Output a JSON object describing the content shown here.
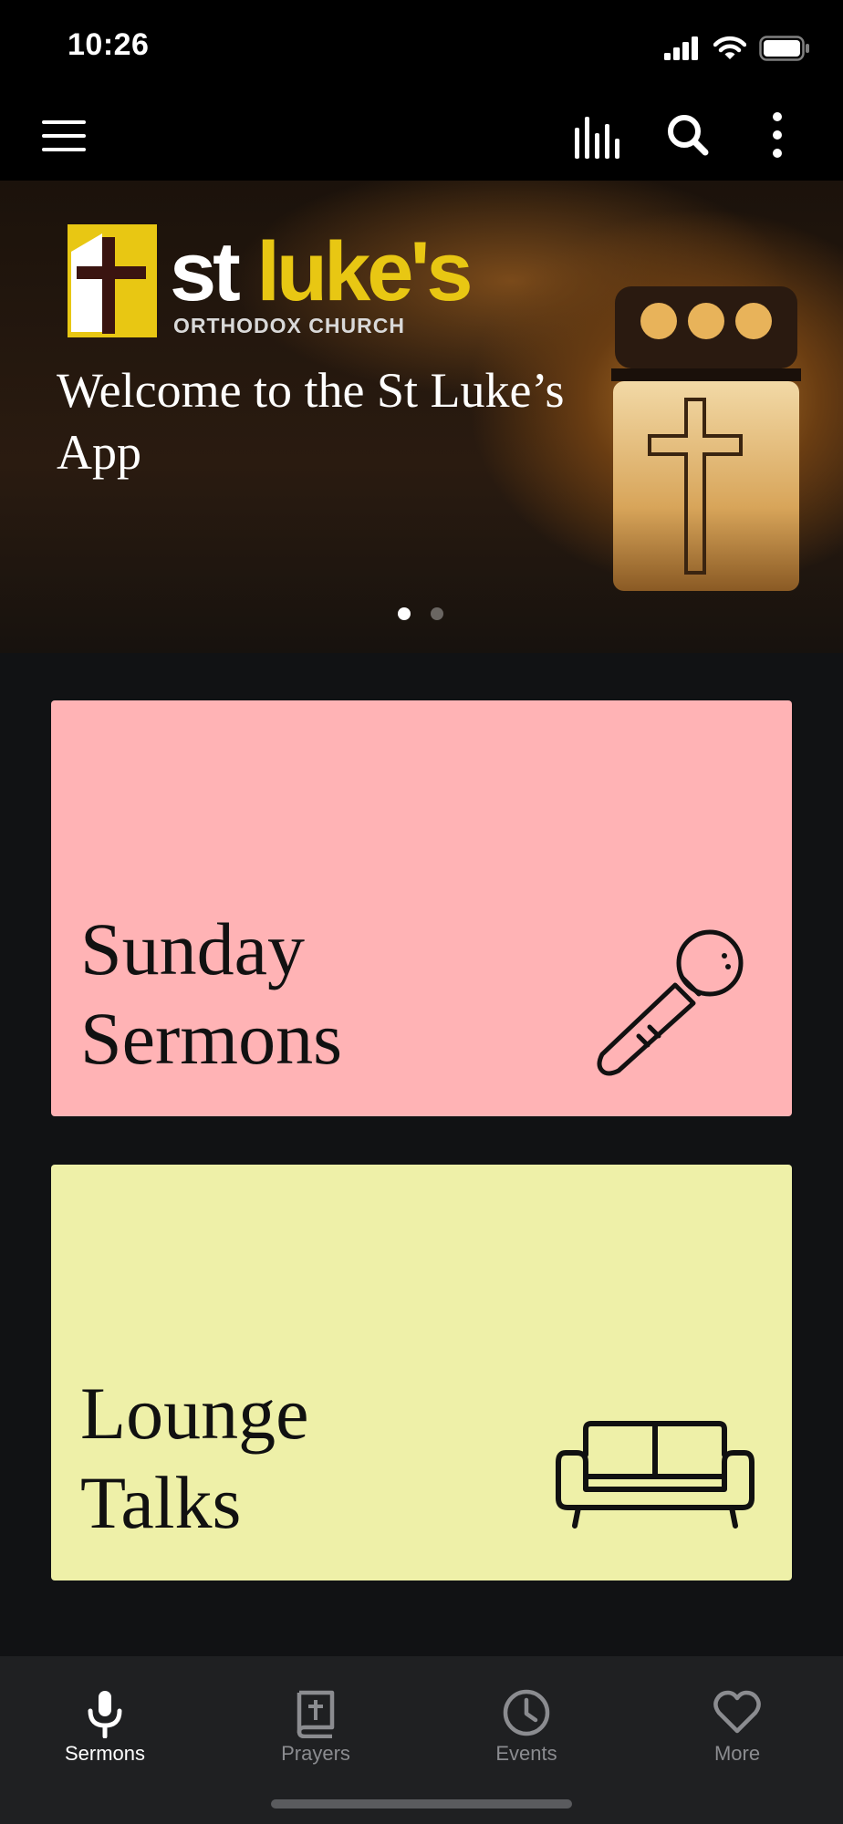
{
  "status_bar": {
    "time": "10:26"
  },
  "top_bar": {
    "menu_icon": "hamburger-menu-icon",
    "equalizer_icon": "equalizer-icon",
    "search_icon": "search-icon",
    "more_icon": "more-vertical-icon"
  },
  "hero": {
    "logo": {
      "name_part1": "st ",
      "name_part2": "luke's",
      "subtitle": "ORTHODOX CHURCH"
    },
    "title": "Welcome to the St Luke’s App",
    "slide_count": 2,
    "active_slide": 1
  },
  "cards": [
    {
      "title": "Sunday Sermons",
      "icon": "microphone-icon",
      "color": "#ffb3b5"
    },
    {
      "title": "Lounge Talks",
      "icon": "sofa-icon",
      "color": "#eef0a8"
    }
  ],
  "tabs": [
    {
      "label": "Sermons",
      "icon": "microphone-icon",
      "active": true
    },
    {
      "label": "Prayers",
      "icon": "bible-icon",
      "active": false
    },
    {
      "label": "Events",
      "icon": "clock-icon",
      "active": false
    },
    {
      "label": "More",
      "icon": "heart-icon",
      "active": false
    }
  ],
  "colors": {
    "accent_yellow": "#e8c713",
    "background": "#111214",
    "tab_bar": "#1f2022"
  }
}
